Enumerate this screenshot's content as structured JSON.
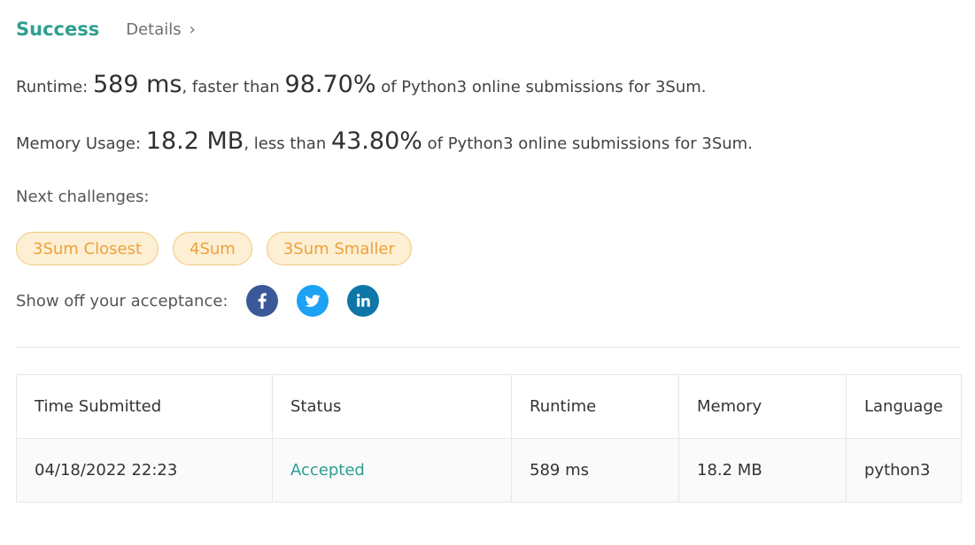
{
  "header": {
    "success_label": "Success",
    "details_label": "Details",
    "details_chevron": "›"
  },
  "runtime": {
    "label": "Runtime: ",
    "value": "589 ms",
    "comparison": ", faster than ",
    "percent": "98.70%",
    "suffix": " of Python3 online submissions for 3Sum."
  },
  "memory": {
    "label": "Memory Usage: ",
    "value": "18.2 MB",
    "comparison": ", less than ",
    "percent": "43.80%",
    "suffix": " of Python3 online submissions for 3Sum."
  },
  "next_challenges": {
    "label": "Next challenges:",
    "items": [
      "3Sum Closest",
      "4Sum",
      "3Sum Smaller"
    ]
  },
  "share": {
    "label": "Show off your acceptance:",
    "icons": [
      "facebook-icon",
      "twitter-icon",
      "linkedin-icon"
    ]
  },
  "table": {
    "headers": [
      "Time Submitted",
      "Status",
      "Runtime",
      "Memory",
      "Language"
    ],
    "rows": [
      [
        "04/18/2022 22:23",
        "Accepted",
        "589 ms",
        "18.2 MB",
        "python3"
      ]
    ]
  },
  "colors": {
    "success": "#2d9f8e",
    "chip_text": "#eda23c",
    "chip_bg": "#fdefd4",
    "facebook": "#3b5998",
    "twitter": "#1da1f2",
    "linkedin": "#0e76a8"
  }
}
